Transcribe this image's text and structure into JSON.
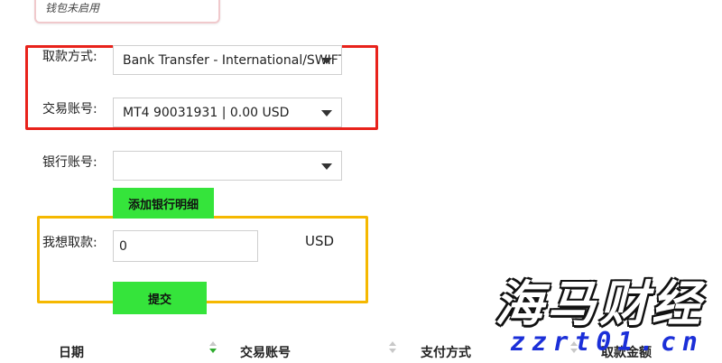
{
  "wallet": {
    "status": "钱包未启用"
  },
  "withdrawal_method": {
    "label": "取款方式:",
    "value": "Bank Transfer - International/SWIFT"
  },
  "trading_account": {
    "label": "交易账号:",
    "value": "MT4 90031931 | 0.00 USD"
  },
  "bank_account": {
    "label": "银行账号:",
    "value": "",
    "add_button": "添加银行明细"
  },
  "amount": {
    "label": "我想取款:",
    "value": "0",
    "currency": "USD"
  },
  "submit_button": "提交",
  "table": {
    "columns": [
      "日期",
      "交易账号",
      "支付方式",
      "取款金额"
    ]
  },
  "watermark": {
    "title": "海马财经",
    "url": "zzrt01.cn"
  },
  "colors": {
    "highlight_red": "#e8221b",
    "highlight_yellow": "#f5b800",
    "button_green": "#35e43b",
    "watermark_blue": "#1b2fd8"
  }
}
